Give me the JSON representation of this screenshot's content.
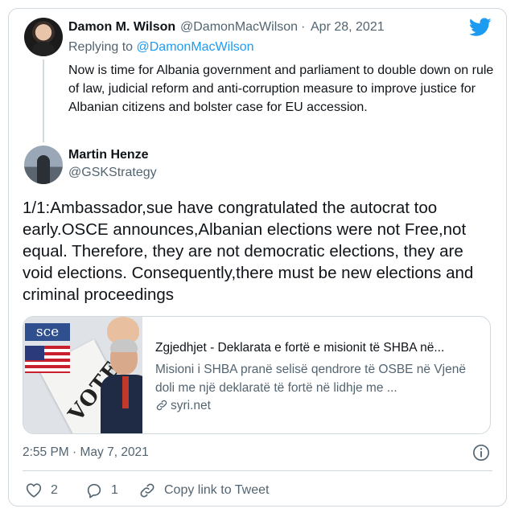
{
  "icons": {
    "brand": "twitter-bird-icon",
    "link": "link-icon",
    "info": "info-icon",
    "like": "heart-icon",
    "reply": "reply-bubble-icon",
    "copy": "link-icon"
  },
  "colors": {
    "accent": "#1d9bf0",
    "secondary_text": "#536471",
    "border": "#cfd9de"
  },
  "parent_tweet": {
    "author_name": "Damon M. Wilson",
    "author_handle": "@DamonMacWilson",
    "separator": "·",
    "date": "Apr 28, 2021",
    "replying_prefix": "Replying to",
    "replying_handle": "@DamonMacWilson",
    "text": "Now is time for Albania government and parliament to double down on rule of law, judicial reform and anti-corruption measure to improve justice for Albanian citizens and bolster case for EU accession."
  },
  "tweet": {
    "author_name": "Martin Henze",
    "author_handle": "@GSKStrategy",
    "text": "1/1:Ambassador,sue have congratulated the autocrat too early.OSCE announces,Albanian elections were not Free,not equal. Therefore, they are not democratic elections, they are void elections. Consequently,there must be new elections and criminal proceedings",
    "timestamp": "2:55 PM · May 7, 2021"
  },
  "link_card": {
    "thumb_osce": "sce",
    "thumb_vote": "VOTE",
    "title": "Zgjedhjet - Deklarata e fortë e misionit të SHBA në...",
    "description": "Misioni i SHBA pranë selisë qendrore të OSBE në Vjenë doli me një deklaratë të fortë në lidhje me ...",
    "domain": "syri.net"
  },
  "actions": {
    "likes": "2",
    "replies": "1",
    "copy_link": "Copy link to Tweet"
  }
}
